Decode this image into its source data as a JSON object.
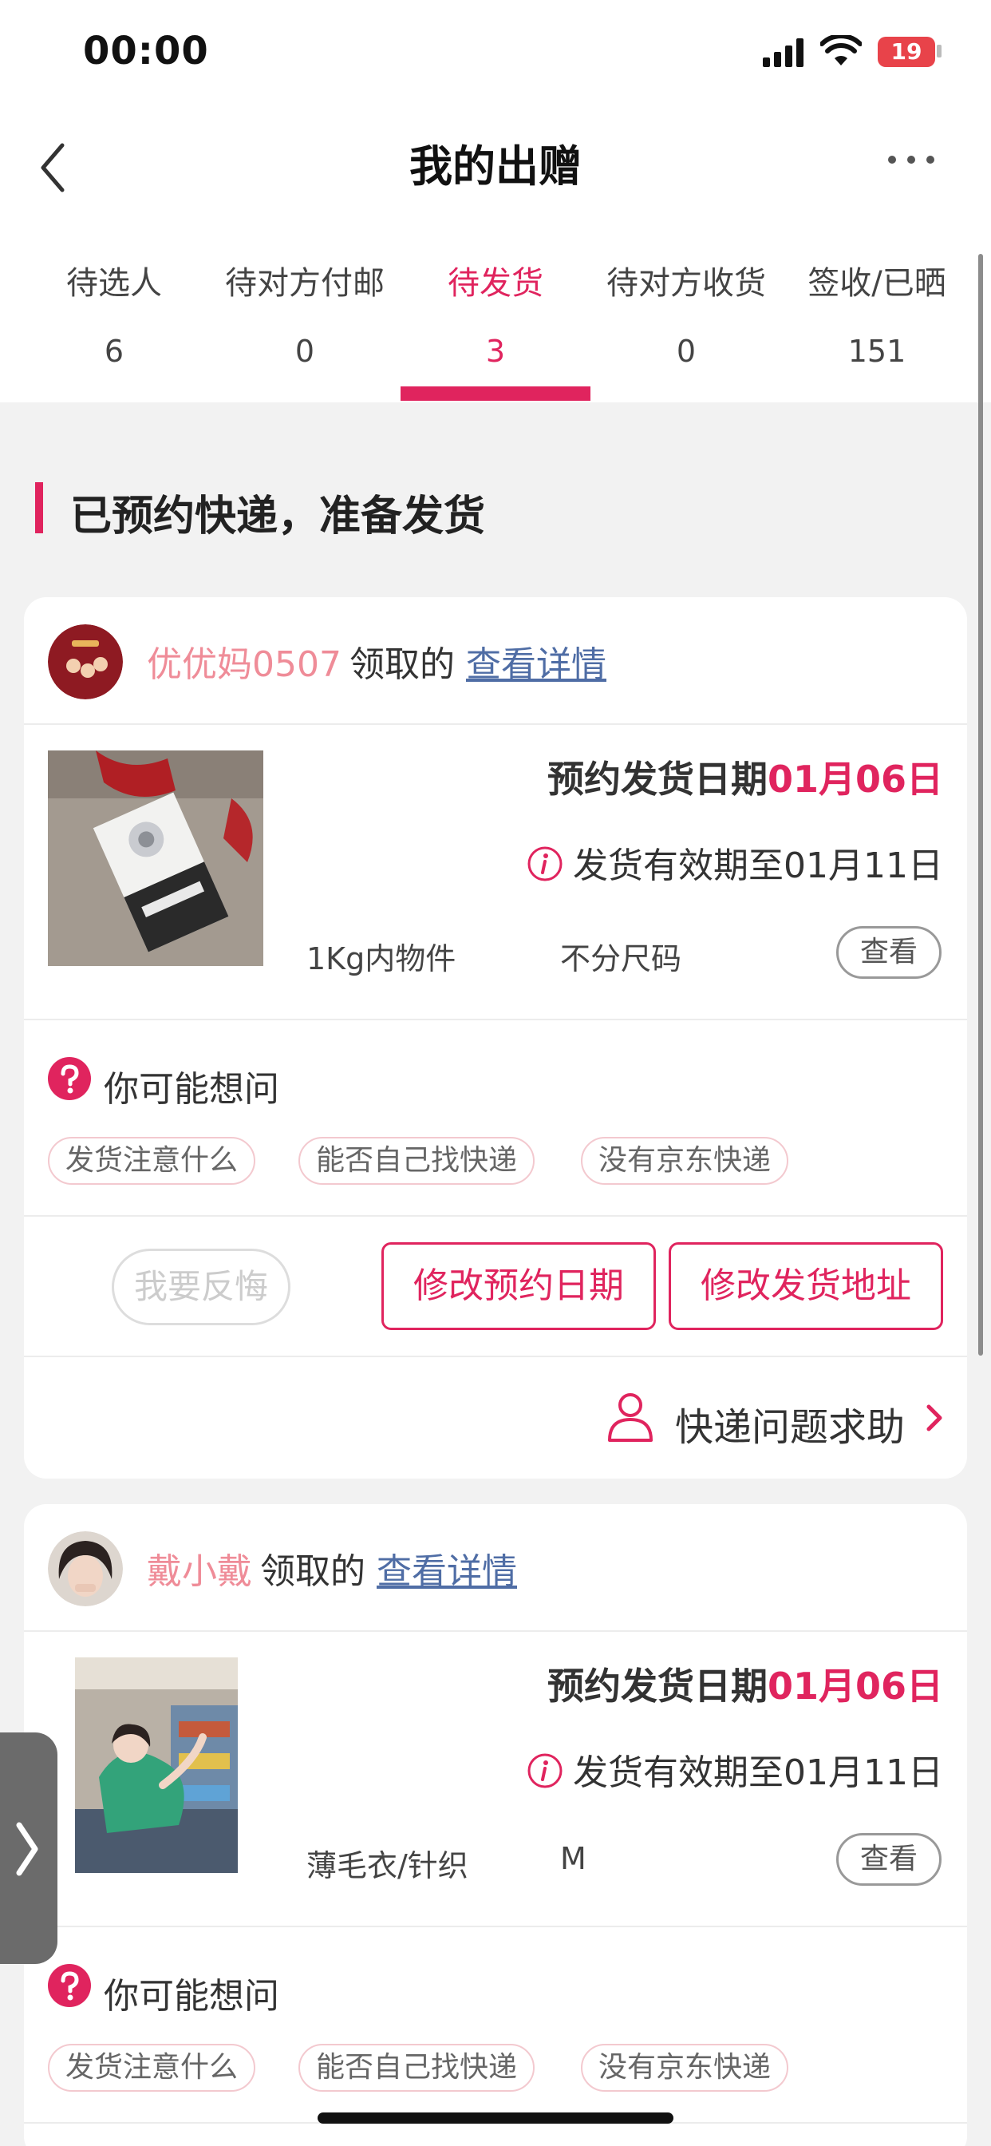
{
  "status_bar": {
    "time": "00:00",
    "battery": "19"
  },
  "header": {
    "title": "我的出赠"
  },
  "tabs": [
    {
      "label": "待选人",
      "count": "6"
    },
    {
      "label": "待对方付邮",
      "count": "0"
    },
    {
      "label": "待发货",
      "count": "3",
      "active": true
    },
    {
      "label": "待对方收货",
      "count": "0"
    },
    {
      "label": "签收/已晒",
      "count": "151"
    }
  ],
  "section": {
    "title": "已预约快递，准备发货"
  },
  "orders": [
    {
      "user_name": "优优妈0507",
      "claimed_suffix": "领取的",
      "detail_link": "查看详情",
      "date_label": "预约发货日期",
      "date_value": "01月06日",
      "valid_text": "发货有效期至01月11日",
      "spec_category": "1Kg内物件",
      "spec_size": "不分尺码",
      "view_label": "查看",
      "faq_title": "你可能想问",
      "faq_chips": [
        "发货注意什么",
        "能否自己找快递",
        "没有京东快递"
      ],
      "regret_label": "我要反悔",
      "modify_date_label": "修改预约日期",
      "modify_address_label": "修改发货地址",
      "help_label": "快递问题求助"
    },
    {
      "user_name": "戴小戴",
      "claimed_suffix": "领取的",
      "detail_link": "查看详情",
      "date_label": "预约发货日期",
      "date_value": "01月06日",
      "valid_text": "发货有效期至01月11日",
      "spec_category": "薄毛衣/针织",
      "spec_size": "M",
      "view_label": "查看",
      "faq_title": "你可能想问",
      "faq_chips": [
        "发货注意什么",
        "能否自己找快递",
        "没有京东快递"
      ]
    }
  ],
  "colors": {
    "accent": "#e0245e",
    "name": "#ef8c98",
    "link": "#4f6da5"
  },
  "icons": [
    "back-icon",
    "more-icon",
    "info-icon",
    "question-icon",
    "person-icon",
    "chevron-right-icon",
    "side-expand-icon"
  ]
}
